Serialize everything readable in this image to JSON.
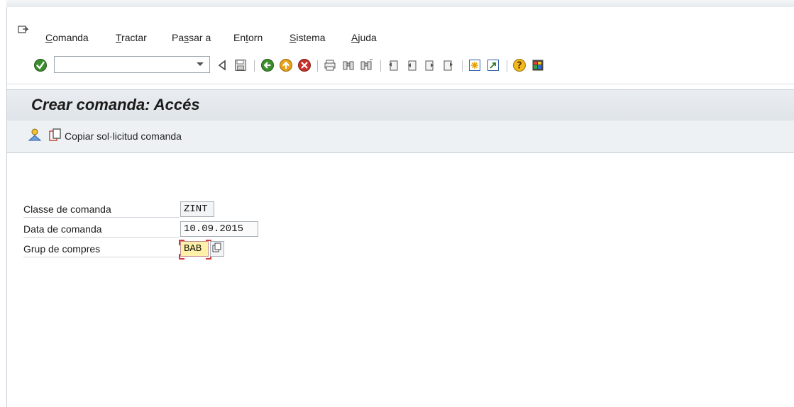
{
  "menu": {
    "items": [
      {
        "id": "comanda",
        "ul": "C",
        "rest": "omanda"
      },
      {
        "id": "tractar",
        "ul": "T",
        "rest": "ractar"
      },
      {
        "id": "passar",
        "pre": "Pa",
        "ul": "s",
        "rest": "sar a"
      },
      {
        "id": "entorn",
        "pre": "En",
        "ul": "t",
        "rest": "orn"
      },
      {
        "id": "sistema",
        "ul": "S",
        "rest": "istema"
      },
      {
        "id": "ajuda",
        "ul": "A",
        "rest": "juda"
      }
    ]
  },
  "toolbar": {
    "command_value": "",
    "icons": [
      "enter-icon",
      "back-triangle-icon",
      "save-icon",
      "back-icon",
      "exit-icon",
      "cancel-icon",
      "print-icon",
      "find-icon",
      "find-next-icon",
      "first-page-icon",
      "previous-page-icon",
      "next-page-icon",
      "last-page-icon",
      "create-session-icon",
      "shortcut-icon",
      "help-icon",
      "customize-layout-icon"
    ]
  },
  "title": "Crear comanda: Accés",
  "app_toolbar": {
    "copy_label": "Copiar sol·licitud comanda"
  },
  "form": {
    "fields": [
      {
        "label": "Classe de comanda",
        "value": "ZINT"
      },
      {
        "label": "Data de comanda",
        "value": "10.09.2015"
      },
      {
        "label": "Grup de compres",
        "value": "BAB"
      }
    ]
  },
  "colors": {
    "accent_green": "#3a8a2a",
    "required_yellow": "#fff2a8",
    "error_red": "#d43a3a",
    "title_bar": "#e3e8ed"
  }
}
